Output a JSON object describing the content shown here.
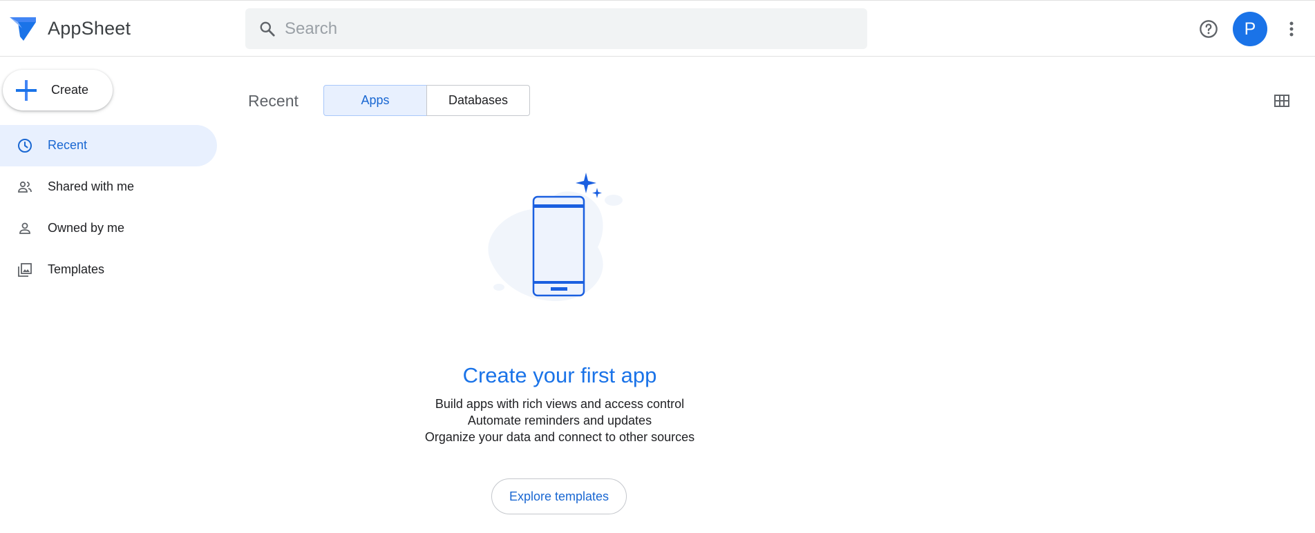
{
  "header": {
    "app_name": "AppSheet",
    "search_placeholder": "Search",
    "avatar_initial": "P",
    "icons": [
      "appsheet-logo-icon",
      "search-icon",
      "help-icon",
      "more-vert-icon"
    ]
  },
  "sidebar": {
    "create_label": "Create",
    "items": [
      {
        "label": "Recent",
        "icon": "clock-icon",
        "active": true
      },
      {
        "label": "Shared with me",
        "icon": "people-icon",
        "active": false
      },
      {
        "label": "Owned by me",
        "icon": "person-icon",
        "active": false
      },
      {
        "label": "Templates",
        "icon": "image-library-icon",
        "active": false
      }
    ]
  },
  "main": {
    "section_title": "Recent",
    "tabs": [
      {
        "label": "Apps",
        "selected": true
      },
      {
        "label": "Databases",
        "selected": false
      }
    ],
    "view_toggle_icon": "grid-view-icon",
    "empty_state": {
      "title": "Create your first app",
      "lines": [
        "Build apps with rich views and access control",
        "Automate reminders and updates",
        "Organize your data and connect to other sources"
      ],
      "button_label": "Explore templates"
    }
  },
  "colors": {
    "accent": "#1a73e8",
    "active_bg": "#e8f0fe",
    "active_text": "#1967d2"
  }
}
